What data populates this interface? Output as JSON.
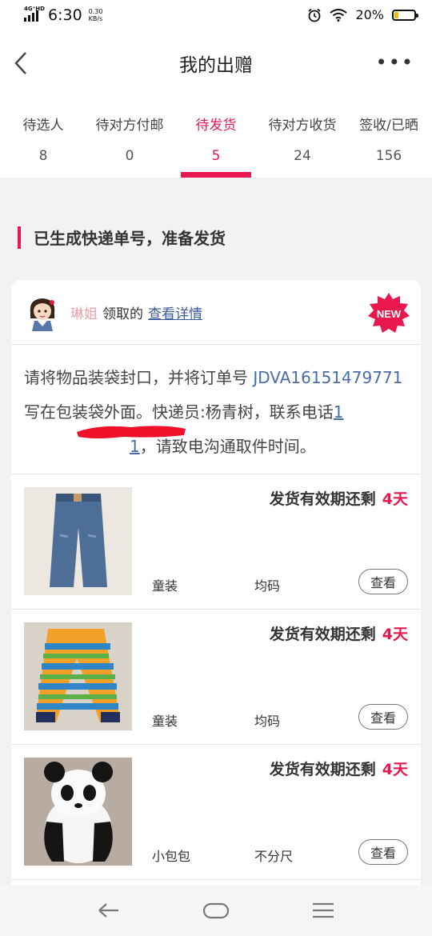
{
  "status_bar": {
    "network": "4G⁺HD",
    "time": "6:30",
    "speed_value": "0.30",
    "speed_unit": "KB/s",
    "battery_text": "20%",
    "battery_level": 0.2,
    "battery_color": "#f5b700"
  },
  "header": {
    "title": "我的出赠",
    "more": "•••"
  },
  "tabs": [
    {
      "label": "待选人",
      "count": "8"
    },
    {
      "label": "待对方付邮",
      "count": "0"
    },
    {
      "label": "待发货",
      "count": "5",
      "active": true
    },
    {
      "label": "待对方收货",
      "count": "24"
    },
    {
      "label": "签收/已晒",
      "count": "156"
    }
  ],
  "accent_color": "#e8184e",
  "section_title": "已生成快递单号，准备发货",
  "order": {
    "user_name": "琳姐",
    "claim_text": "领取的",
    "detail_link": "查看详情",
    "badge": "NEW",
    "notice_part1": "请将物品装袋封口，并将订单号 ",
    "tracking_no": "JDVA16151479771",
    "notice_part2": " 写在包装袋外面。快递员:杨青树，联系电话",
    "phone_visible": "1",
    "phone_tail": "1",
    "notice_part3": "，请致电沟通取件时间。"
  },
  "items": [
    {
      "deadline_label": "发货有效期还剩",
      "days": "4天",
      "category": "童装",
      "size": "均码",
      "view": "查看"
    },
    {
      "deadline_label": "发货有效期还剩",
      "days": "4天",
      "category": "童装",
      "size": "均码",
      "view": "查看"
    },
    {
      "deadline_label": "发货有效期还剩",
      "days": "4天",
      "category": "小包包",
      "size": "不分尺",
      "view": "查看"
    }
  ]
}
